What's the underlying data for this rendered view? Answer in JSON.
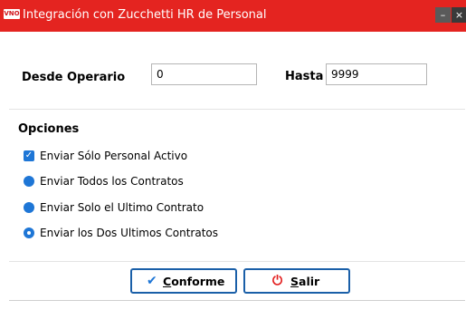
{
  "window": {
    "title": "Integración con Zucchetti HR de Personal",
    "app_icon_text": "VNO",
    "minimize_glyph": "–",
    "close_glyph": "×",
    "title_color": "#e42420"
  },
  "range": {
    "from_label": "Desde Operario",
    "from_value": "0",
    "to_label": "Hasta",
    "to_value": "9999"
  },
  "options": {
    "title": "Opciones",
    "items": [
      {
        "label": "Enviar Sólo Personal Activo",
        "control": "checkbox",
        "checked": true
      },
      {
        "label": "Enviar Todos los Contratos",
        "control": "radio",
        "checked": false
      },
      {
        "label": "Enviar Solo el Ultimo Contrato",
        "control": "radio",
        "checked": false
      },
      {
        "label": "Enviar los Dos Ultimos Contratos",
        "control": "radio",
        "checked": true
      }
    ]
  },
  "buttons": {
    "confirm_label_first": "C",
    "confirm_label_rest": "onforme",
    "confirm_icon": "check-icon",
    "exit_label_first": "S",
    "exit_label_rest": "alir",
    "exit_icon": "power-icon"
  },
  "colors": {
    "accent": "#1e76d6",
    "button_border": "#1a5fa8",
    "exit_icon": "#e21b1b"
  }
}
